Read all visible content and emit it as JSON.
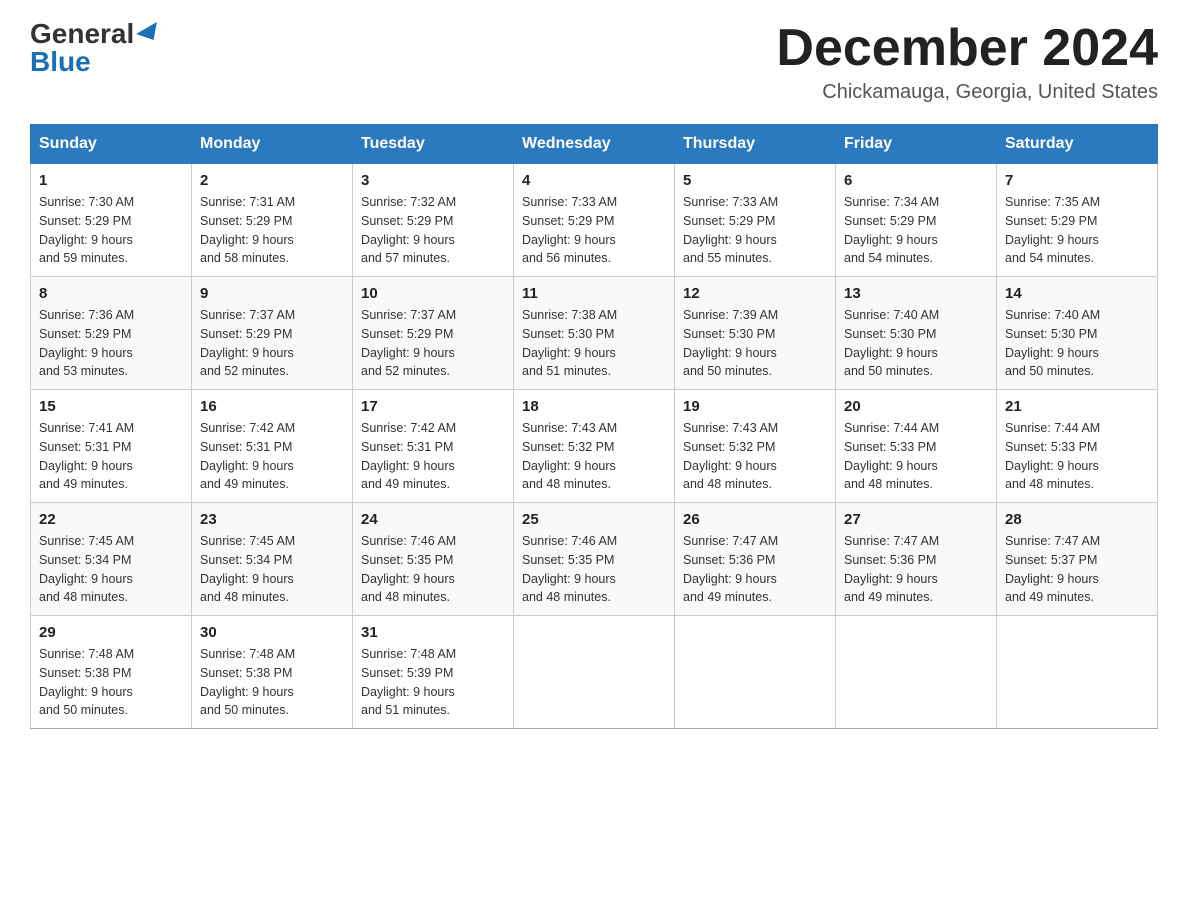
{
  "header": {
    "logo_general": "General",
    "logo_blue": "Blue",
    "month_title": "December 2024",
    "location": "Chickamauga, Georgia, United States"
  },
  "days_of_week": [
    "Sunday",
    "Monday",
    "Tuesday",
    "Wednesday",
    "Thursday",
    "Friday",
    "Saturday"
  ],
  "weeks": [
    [
      {
        "day": "1",
        "sunrise": "7:30 AM",
        "sunset": "5:29 PM",
        "daylight": "9 hours and 59 minutes."
      },
      {
        "day": "2",
        "sunrise": "7:31 AM",
        "sunset": "5:29 PM",
        "daylight": "9 hours and 58 minutes."
      },
      {
        "day": "3",
        "sunrise": "7:32 AM",
        "sunset": "5:29 PM",
        "daylight": "9 hours and 57 minutes."
      },
      {
        "day": "4",
        "sunrise": "7:33 AM",
        "sunset": "5:29 PM",
        "daylight": "9 hours and 56 minutes."
      },
      {
        "day": "5",
        "sunrise": "7:33 AM",
        "sunset": "5:29 PM",
        "daylight": "9 hours and 55 minutes."
      },
      {
        "day": "6",
        "sunrise": "7:34 AM",
        "sunset": "5:29 PM",
        "daylight": "9 hours and 54 minutes."
      },
      {
        "day": "7",
        "sunrise": "7:35 AM",
        "sunset": "5:29 PM",
        "daylight": "9 hours and 54 minutes."
      }
    ],
    [
      {
        "day": "8",
        "sunrise": "7:36 AM",
        "sunset": "5:29 PM",
        "daylight": "9 hours and 53 minutes."
      },
      {
        "day": "9",
        "sunrise": "7:37 AM",
        "sunset": "5:29 PM",
        "daylight": "9 hours and 52 minutes."
      },
      {
        "day": "10",
        "sunrise": "7:37 AM",
        "sunset": "5:29 PM",
        "daylight": "9 hours and 52 minutes."
      },
      {
        "day": "11",
        "sunrise": "7:38 AM",
        "sunset": "5:30 PM",
        "daylight": "9 hours and 51 minutes."
      },
      {
        "day": "12",
        "sunrise": "7:39 AM",
        "sunset": "5:30 PM",
        "daylight": "9 hours and 50 minutes."
      },
      {
        "day": "13",
        "sunrise": "7:40 AM",
        "sunset": "5:30 PM",
        "daylight": "9 hours and 50 minutes."
      },
      {
        "day": "14",
        "sunrise": "7:40 AM",
        "sunset": "5:30 PM",
        "daylight": "9 hours and 50 minutes."
      }
    ],
    [
      {
        "day": "15",
        "sunrise": "7:41 AM",
        "sunset": "5:31 PM",
        "daylight": "9 hours and 49 minutes."
      },
      {
        "day": "16",
        "sunrise": "7:42 AM",
        "sunset": "5:31 PM",
        "daylight": "9 hours and 49 minutes."
      },
      {
        "day": "17",
        "sunrise": "7:42 AM",
        "sunset": "5:31 PM",
        "daylight": "9 hours and 49 minutes."
      },
      {
        "day": "18",
        "sunrise": "7:43 AM",
        "sunset": "5:32 PM",
        "daylight": "9 hours and 48 minutes."
      },
      {
        "day": "19",
        "sunrise": "7:43 AM",
        "sunset": "5:32 PM",
        "daylight": "9 hours and 48 minutes."
      },
      {
        "day": "20",
        "sunrise": "7:44 AM",
        "sunset": "5:33 PM",
        "daylight": "9 hours and 48 minutes."
      },
      {
        "day": "21",
        "sunrise": "7:44 AM",
        "sunset": "5:33 PM",
        "daylight": "9 hours and 48 minutes."
      }
    ],
    [
      {
        "day": "22",
        "sunrise": "7:45 AM",
        "sunset": "5:34 PM",
        "daylight": "9 hours and 48 minutes."
      },
      {
        "day": "23",
        "sunrise": "7:45 AM",
        "sunset": "5:34 PM",
        "daylight": "9 hours and 48 minutes."
      },
      {
        "day": "24",
        "sunrise": "7:46 AM",
        "sunset": "5:35 PM",
        "daylight": "9 hours and 48 minutes."
      },
      {
        "day": "25",
        "sunrise": "7:46 AM",
        "sunset": "5:35 PM",
        "daylight": "9 hours and 48 minutes."
      },
      {
        "day": "26",
        "sunrise": "7:47 AM",
        "sunset": "5:36 PM",
        "daylight": "9 hours and 49 minutes."
      },
      {
        "day": "27",
        "sunrise": "7:47 AM",
        "sunset": "5:36 PM",
        "daylight": "9 hours and 49 minutes."
      },
      {
        "day": "28",
        "sunrise": "7:47 AM",
        "sunset": "5:37 PM",
        "daylight": "9 hours and 49 minutes."
      }
    ],
    [
      {
        "day": "29",
        "sunrise": "7:48 AM",
        "sunset": "5:38 PM",
        "daylight": "9 hours and 50 minutes."
      },
      {
        "day": "30",
        "sunrise": "7:48 AM",
        "sunset": "5:38 PM",
        "daylight": "9 hours and 50 minutes."
      },
      {
        "day": "31",
        "sunrise": "7:48 AM",
        "sunset": "5:39 PM",
        "daylight": "9 hours and 51 minutes."
      },
      null,
      null,
      null,
      null
    ]
  ],
  "labels": {
    "sunrise_prefix": "Sunrise: ",
    "sunset_prefix": "Sunset: ",
    "daylight_prefix": "Daylight: "
  }
}
